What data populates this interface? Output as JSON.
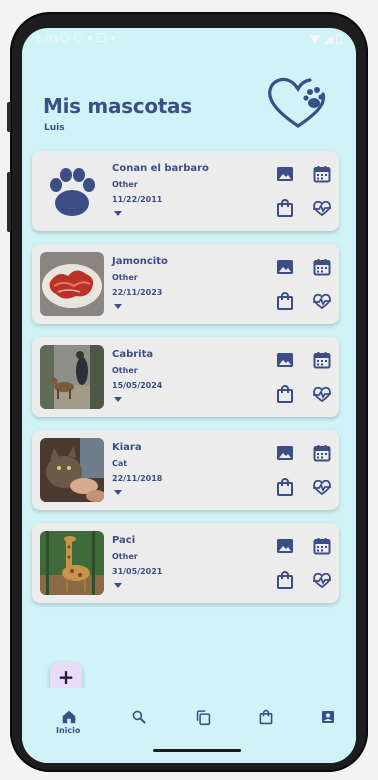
{
  "statusbar": {
    "time": "5:03"
  },
  "header": {
    "title": "Mis mascotas",
    "user": "Luis",
    "logo_icon": "heart-paw-icon"
  },
  "colors": {
    "primary": "#3d4e86",
    "background": "#cff3f6",
    "card": "#ececec",
    "fab": "#e8dcf8"
  },
  "pets": [
    {
      "name": "Conan el barbaro",
      "type": "Other",
      "date": "11/22/2011",
      "photo": "paw-placeholder"
    },
    {
      "name": "Jamoncito",
      "type": "Other",
      "date": "22/11/2023",
      "photo": "ham-photo"
    },
    {
      "name": "Cabrita",
      "type": "Other",
      "date": "15/05/2024",
      "photo": "goat-photo"
    },
    {
      "name": "Kiara",
      "type": "Cat",
      "date": "22/11/2018",
      "photo": "cat-photo"
    },
    {
      "name": "Paci",
      "type": "Other",
      "date": "31/05/2021",
      "photo": "giraffe-photo"
    }
  ],
  "card_actions": [
    "image-icon",
    "calendar-icon",
    "shopping-bag-icon",
    "health-icon"
  ],
  "fab": {
    "label": "+"
  },
  "nav": {
    "items": [
      {
        "icon": "home-icon",
        "label": "Inicio",
        "active": true
      },
      {
        "icon": "search-icon"
      },
      {
        "icon": "copy-icon"
      },
      {
        "icon": "shopping-bag-icon"
      },
      {
        "icon": "profile-icon"
      }
    ]
  }
}
